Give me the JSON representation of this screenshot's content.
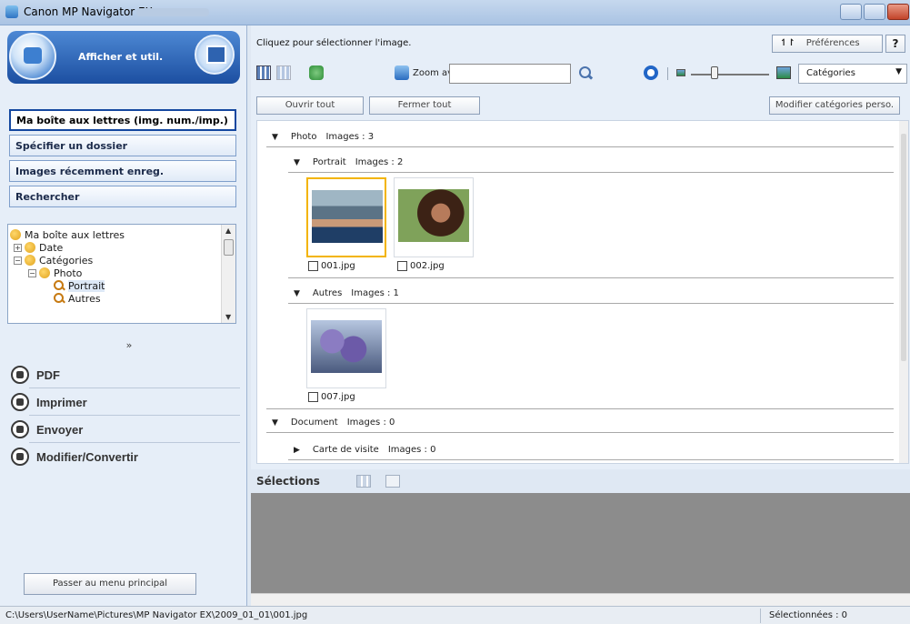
{
  "window": {
    "title": "Canon MP Navigator EX"
  },
  "left": {
    "banner_label": "Afficher et util.",
    "nav": [
      "Ma boîte aux lettres (img. num./imp.)",
      "Spécifier un dossier",
      "Images récemment enreg.",
      "Rechercher"
    ],
    "tree": [
      "Ma boîte aux lettres",
      "Date",
      "Catégories",
      "Photo",
      "Portrait",
      "Autres"
    ],
    "chevron": "»",
    "actions": [
      "PDF",
      "Imprimer",
      "Envoyer",
      "Modifier/Convertir"
    ],
    "main_menu_btn": "Passer au menu principal"
  },
  "toolbar": {
    "hint": "Cliquez pour sélectionner l'image.",
    "preferences": "Préférences",
    "help": "?",
    "zoom_label": "Zoom avant",
    "search_value": "",
    "category_select": "Catégories",
    "open_all": "Ouvrir tout",
    "close_all": "Fermer tout",
    "modify_categories": "Modifier catégories perso."
  },
  "content": {
    "groups": [
      {
        "name": "Photo",
        "count": "Images : 3"
      },
      {
        "name": "Portrait",
        "count": "Images : 2"
      },
      {
        "name": "Autres",
        "count": "Images : 1"
      },
      {
        "name": "Document",
        "count": "Images : 0"
      },
      {
        "name": "Carte de visite",
        "count": "Images : 0"
      }
    ],
    "images": [
      {
        "file": "001.jpg",
        "selected": true
      },
      {
        "file": "002.jpg",
        "selected": false
      },
      {
        "file": "007.jpg",
        "selected": false
      }
    ]
  },
  "selections": {
    "label": "Sélections"
  },
  "status": {
    "path": "C:\\Users\\UserName\\Pictures\\MP Navigator EX\\2009_01_01\\001.jpg",
    "selected": "Sélectionnées : 0"
  },
  "colors": {
    "accent": "#14479f",
    "selection": "#f3b400",
    "tray": "#8c8c8c"
  }
}
